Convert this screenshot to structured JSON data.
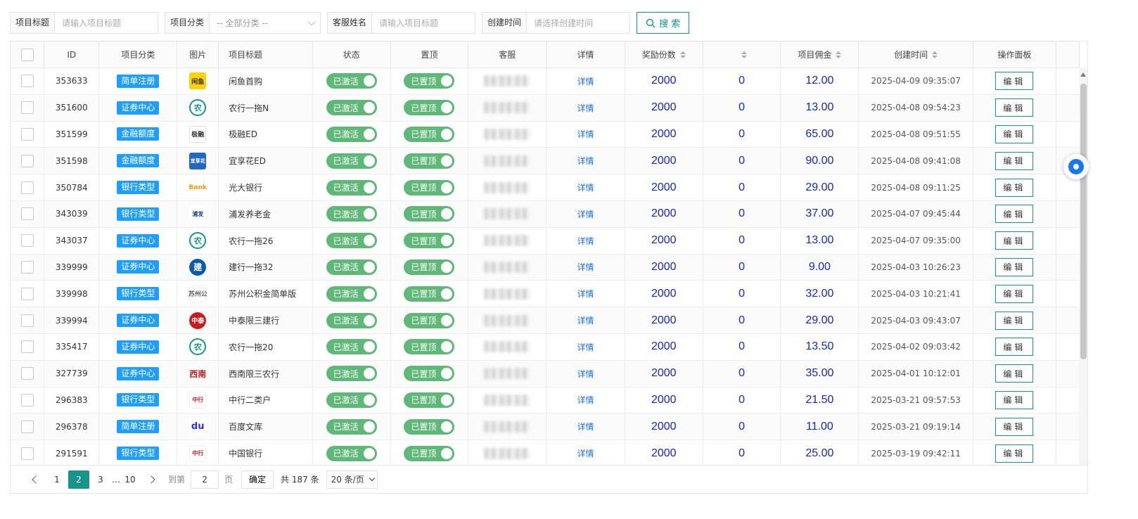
{
  "filters": {
    "title_label": "项目标题",
    "title_placeholder": "请输入项目标题",
    "category_label": "项目分类",
    "category_value": "-- 全部分类 --",
    "agent_label": "客服姓名",
    "agent_placeholder": "请输入项目标题",
    "time_label": "创建时间",
    "time_placeholder": "请选择创建时间",
    "search_label": "搜 索"
  },
  "table": {
    "headers": {
      "id": "ID",
      "category": "项目分类",
      "image": "图片",
      "title": "项目标题",
      "status": "状态",
      "top": "置顶",
      "agent": "客服",
      "detail": "详情",
      "reward": "奖励份数",
      "count": "",
      "fee": "项目佣金",
      "time": "创建时间",
      "ops": "操作面板"
    },
    "status_on": "已激活",
    "top_on": "已置顶",
    "detail_link": "详情",
    "edit_label": "编辑",
    "rows": [
      {
        "id": "353633",
        "category": "简单注册",
        "thumb": "xianyu",
        "thumb_text": "闲鱼",
        "title": "闲鱼首购",
        "reward": "2000",
        "count": "0",
        "fee": "12.00",
        "time": "2025-04-09 09:35:07"
      },
      {
        "id": "351600",
        "category": "证券中心",
        "thumb": "abc",
        "thumb_text": "农",
        "title": "农行一拖N",
        "reward": "2000",
        "count": "0",
        "fee": "13.00",
        "time": "2025-04-08 09:54:23"
      },
      {
        "id": "351599",
        "category": "金融额度",
        "thumb": "jirong",
        "thumb_text": "极融",
        "title": "极融ED",
        "reward": "2000",
        "count": "0",
        "fee": "65.00",
        "time": "2025-04-08 09:51:55"
      },
      {
        "id": "351598",
        "category": "金融额度",
        "thumb": "yixiang",
        "thumb_text": "宜享花",
        "title": "宜享花ED",
        "reward": "2000",
        "count": "0",
        "fee": "90.00",
        "time": "2025-04-08 09:41:08"
      },
      {
        "id": "350784",
        "category": "银行类型",
        "thumb": "bank",
        "thumb_text": "Bank",
        "title": "光大银行",
        "reward": "2000",
        "count": "0",
        "fee": "29.00",
        "time": "2025-04-08 09:11:25"
      },
      {
        "id": "343039",
        "category": "银行类型",
        "thumb": "pufa",
        "thumb_text": "浦发",
        "title": "浦发养老金",
        "reward": "2000",
        "count": "0",
        "fee": "37.00",
        "time": "2025-04-07 09:45:44"
      },
      {
        "id": "343037",
        "category": "证券中心",
        "thumb": "abc",
        "thumb_text": "农",
        "title": "农行一拖26",
        "reward": "2000",
        "count": "0",
        "fee": "13.00",
        "time": "2025-04-07 09:35:00"
      },
      {
        "id": "339999",
        "category": "证券中心",
        "thumb": "ccb",
        "thumb_text": "建",
        "title": "建行一拖32",
        "reward": "2000",
        "count": "0",
        "fee": "9.00",
        "time": "2025-04-03 10:26:23"
      },
      {
        "id": "339998",
        "category": "银行类型",
        "thumb": "suzhou",
        "thumb_text": "苏州公",
        "title": "苏州公积金简单版",
        "reward": "2000",
        "count": "0",
        "fee": "32.00",
        "time": "2025-04-03 10:21:41"
      },
      {
        "id": "339994",
        "category": "证券中心",
        "thumb": "zhongtai",
        "thumb_text": "中泰",
        "title": "中泰限三建行",
        "reward": "2000",
        "count": "0",
        "fee": "29.00",
        "time": "2025-04-03 09:43:07"
      },
      {
        "id": "335417",
        "category": "证券中心",
        "thumb": "abc",
        "thumb_text": "农",
        "title": "农行一拖20",
        "reward": "2000",
        "count": "0",
        "fee": "13.50",
        "time": "2025-04-02 09:03:42"
      },
      {
        "id": "327739",
        "category": "证券中心",
        "thumb": "xinan",
        "thumb_text": "西南",
        "title": "西南限三农行",
        "reward": "2000",
        "count": "0",
        "fee": "35.00",
        "time": "2025-04-01 10:12:01"
      },
      {
        "id": "296383",
        "category": "银行类型",
        "thumb": "boc",
        "thumb_text": "中行",
        "title": "中行二类户",
        "reward": "2000",
        "count": "0",
        "fee": "21.50",
        "time": "2025-03-21 09:57:53"
      },
      {
        "id": "296378",
        "category": "简单注册",
        "thumb": "baidu",
        "thumb_text": "du",
        "title": "百度文库",
        "reward": "2000",
        "count": "0",
        "fee": "11.00",
        "time": "2025-03-21 09:19:14"
      },
      {
        "id": "291591",
        "category": "银行类型",
        "thumb": "boc",
        "thumb_text": "中行",
        "title": "中国银行",
        "reward": "2000",
        "count": "0",
        "fee": "25.00",
        "time": "2025-03-19 09:42:11"
      }
    ]
  },
  "pagination": {
    "pages": [
      "1",
      "2",
      "3"
    ],
    "active": "2",
    "ellipsis": "…",
    "last": "10",
    "goto_prefix": "到第",
    "goto_value": "2",
    "goto_suffix": "页",
    "confirm": "确定",
    "total": "共 187 条",
    "page_size": "20 条/页"
  },
  "colors": {
    "accent": "#16958a",
    "badge": "#1e9fff",
    "switch": "#5fb878",
    "number": "#1726b6"
  }
}
